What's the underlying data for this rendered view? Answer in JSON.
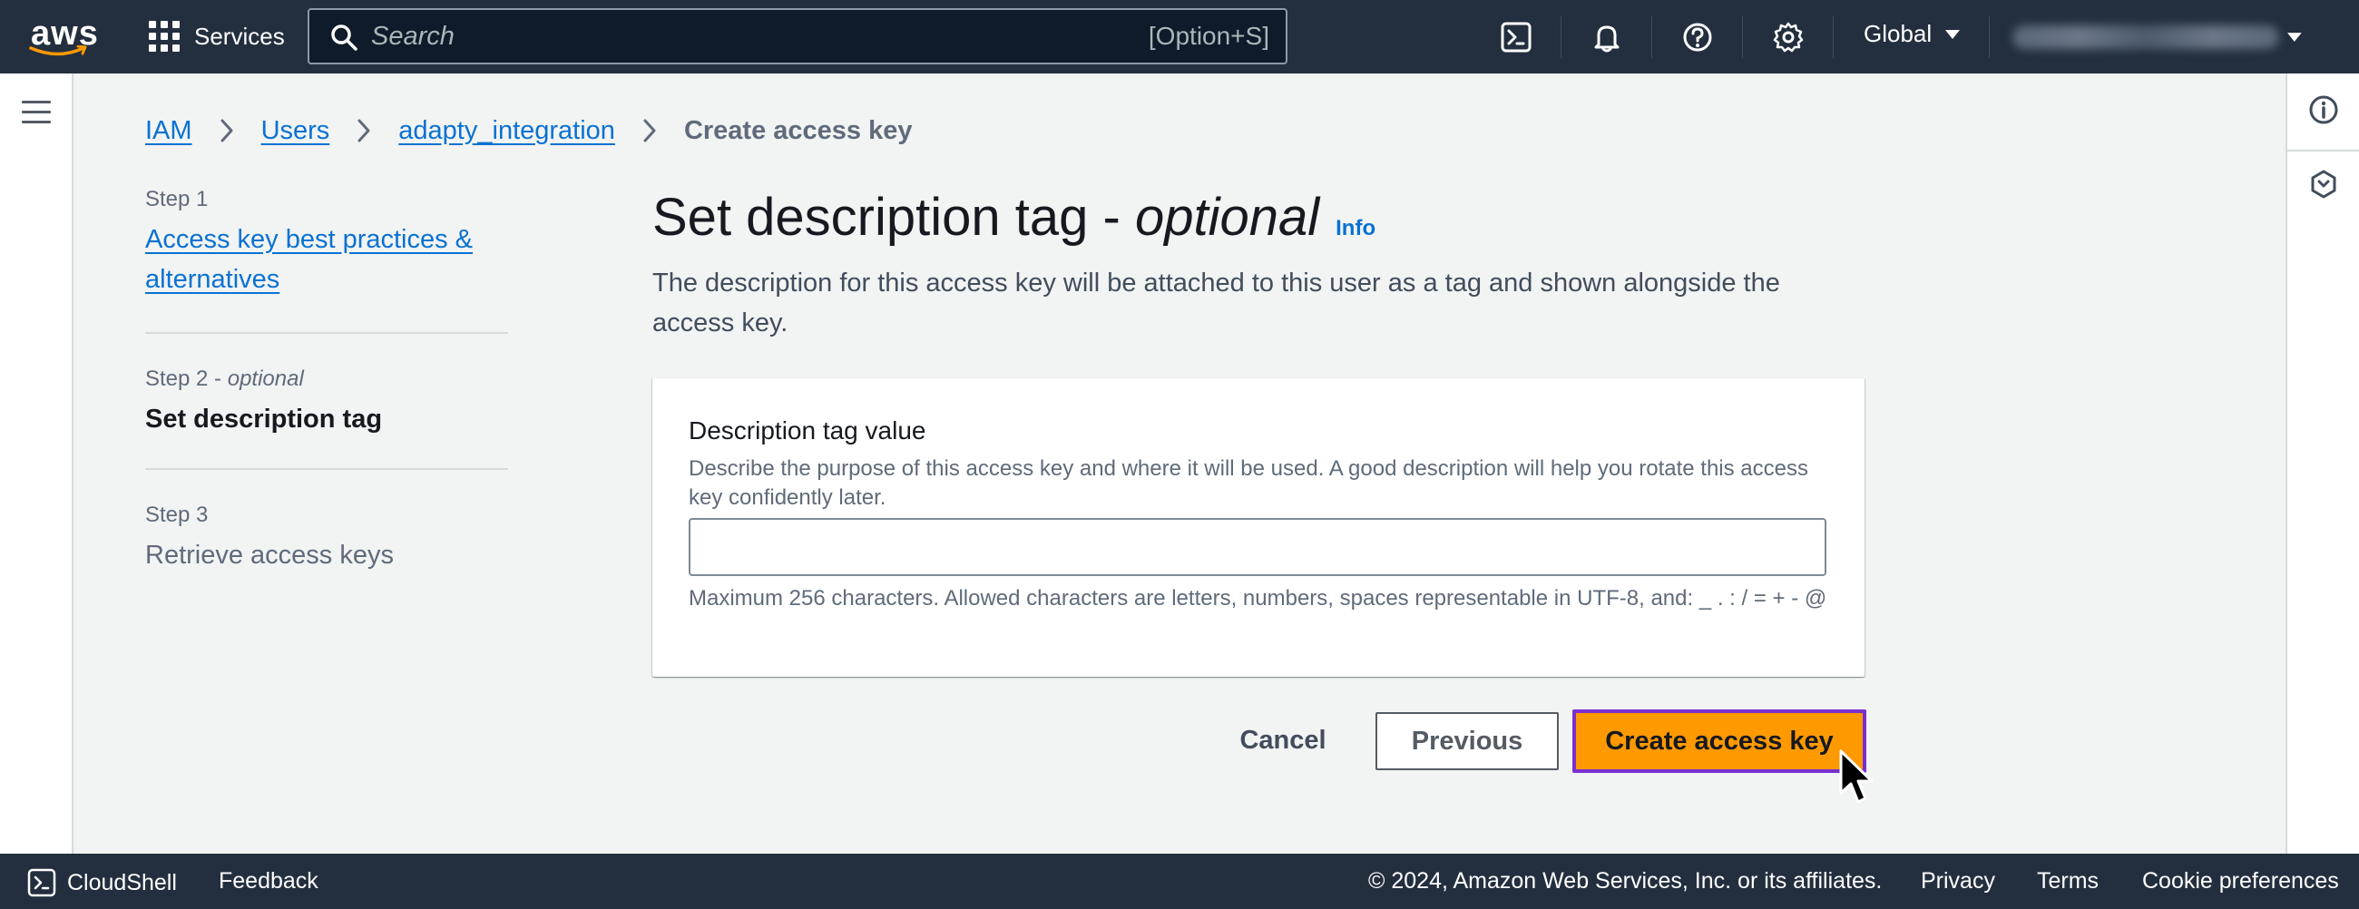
{
  "topnav": {
    "logo_text": "aws",
    "services_label": "Services",
    "search_placeholder": "Search",
    "search_shortcut": "[Option+S]",
    "region_label": "Global"
  },
  "breadcrumb": {
    "items": [
      "IAM",
      "Users",
      "adapty_integration"
    ],
    "current": "Create access key"
  },
  "steps": [
    {
      "label": "Step 1",
      "title": "Access key best practices & alternatives",
      "state": "link"
    },
    {
      "label": "Step 2",
      "label_suffix": "optional",
      "title": "Set description tag",
      "state": "current"
    },
    {
      "label": "Step 3",
      "title": "Retrieve access keys",
      "state": "disabled"
    }
  ],
  "main": {
    "title": "Set description tag - ",
    "title_em": "optional",
    "info_label": "Info",
    "description": "The description for this access key will be attached to this user as a tag and shown alongside the access key."
  },
  "form": {
    "field_label": "Description tag value",
    "field_description": "Describe the purpose of this access key and where it will be used. A good description will help you rotate this access key confidently later.",
    "field_value": "",
    "field_hint": "Maximum 256 characters. Allowed characters are letters, numbers, spaces representable in UTF-8, and: _ . : / = + - @"
  },
  "actions": {
    "cancel_label": "Cancel",
    "previous_label": "Previous",
    "create_label": "Create access key"
  },
  "footer": {
    "cloudshell_label": "CloudShell",
    "feedback_label": "Feedback",
    "copyright": "© 2024, Amazon Web Services, Inc. or its affiliates.",
    "privacy_label": "Privacy",
    "terms_label": "Terms",
    "cookie_label": "Cookie preferences"
  },
  "colors": {
    "nav_bg": "#232f3e",
    "link": "#0972d3",
    "primary_button": "#ff9900",
    "focus_ring": "#7b2fd1"
  }
}
